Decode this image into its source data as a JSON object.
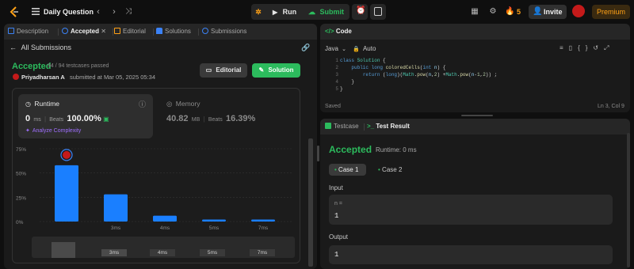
{
  "topbar": {
    "problem_title": "Daily Question",
    "run_label": "Run",
    "submit_label": "Submit",
    "streak_count": "5",
    "invite_label": "Invite",
    "premium_label": "Premium"
  },
  "left_tabs": [
    {
      "label": "Description",
      "color": "#3b82f6"
    },
    {
      "label": "Accepted",
      "color": "#3b82f6",
      "close": "✕"
    },
    {
      "label": "Editorial",
      "color": "#ffa116"
    },
    {
      "label": "Solutions",
      "color": "#3b82f6"
    },
    {
      "label": "Submissions",
      "color": "#3b82f6"
    }
  ],
  "submission": {
    "back_label": "All Submissions",
    "status": "Accepted",
    "testcases": "94 / 94 testcases passed",
    "user": "Priyadharsan A",
    "submitted_text": "submitted at Mar 05, 2025 05:34",
    "editorial_btn": "Editorial",
    "solution_btn": "Solution"
  },
  "runtime": {
    "title": "Runtime",
    "value": "0",
    "unit": "ms",
    "beats_label": "Beats",
    "beats_value": "100.00%",
    "analyze": "Analyze Complexity"
  },
  "memory": {
    "title": "Memory",
    "value": "40.82",
    "unit": "MB",
    "beats_label": "Beats",
    "beats_value": "16.39%"
  },
  "chart_data": {
    "type": "bar",
    "ylim": [
      0,
      75
    ],
    "yticks": [
      "75%",
      "50%",
      "25%",
      "0%"
    ],
    "categories": [
      "",
      "3ms",
      "4ms",
      "5ms",
      "7ms"
    ],
    "values": [
      58,
      28,
      6,
      2,
      2
    ],
    "bar_color": "#1a7fff"
  },
  "minimap_labels": [
    "3ms",
    "4ms",
    "5ms",
    "7ms"
  ],
  "code_panel": {
    "title": "Code",
    "language": "Java",
    "auto_label": "Auto",
    "saved_label": "Saved",
    "cursor_pos": "Ln 3, Col 9",
    "lines": [
      "class Solution {",
      "    public long coloredCells(int n) {",
      "        return (long)(Math.pow(n,2) +Math.pow(n-1,2)) ;",
      "    }",
      "}"
    ]
  },
  "result_panel": {
    "testcase_tab": "Testcase",
    "result_tab": "Test Result",
    "status": "Accepted",
    "runtime_text": "Runtime: 0 ms",
    "case1": "Case 1",
    "case2": "Case 2",
    "input_label": "Input",
    "input_var": "n =",
    "input_value": "1",
    "output_label": "Output",
    "output_value": "1"
  }
}
